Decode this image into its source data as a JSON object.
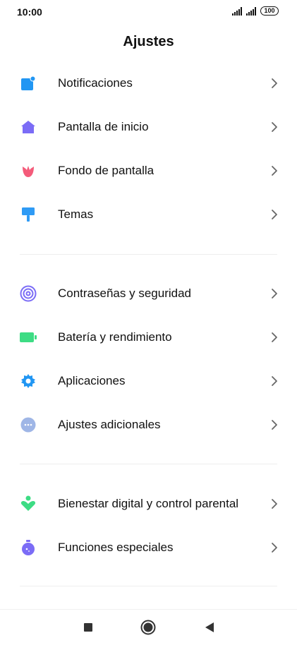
{
  "status_bar": {
    "time": "10:00",
    "battery": "100"
  },
  "header": {
    "title": "Ajustes"
  },
  "sections": [
    {
      "items": [
        {
          "label": "Notificaciones",
          "icon": "notifications-icon",
          "color": "#2196F3"
        },
        {
          "label": "Pantalla de inicio",
          "icon": "home-icon",
          "color": "#7B6CF6"
        },
        {
          "label": "Fondo de pantalla",
          "icon": "wallpaper-tulip-icon",
          "color": "#F45B7A"
        },
        {
          "label": "Temas",
          "icon": "themes-brush-icon",
          "color": "#2F9BF5"
        }
      ]
    },
    {
      "items": [
        {
          "label": "Contraseñas y seguridad",
          "icon": "fingerprint-icon",
          "color": "#7B6CF6"
        },
        {
          "label": "Batería y rendimiento",
          "icon": "battery-icon",
          "color": "#3DDC84"
        },
        {
          "label": "Aplicaciones",
          "icon": "gear-icon",
          "color": "#2196F3"
        },
        {
          "label": "Ajustes adicionales",
          "icon": "more-dots-icon",
          "color": "#9FB6E6"
        }
      ]
    },
    {
      "items": [
        {
          "label": "Bienestar digital y control parental",
          "icon": "digital-wellbeing-icon",
          "color": "#3DDC84"
        },
        {
          "label": "Funciones especiales",
          "icon": "special-features-flask-icon",
          "color": "#7B6CF6"
        }
      ]
    }
  ],
  "nav_bar": {
    "buttons": [
      "recents-square-icon",
      "home-circle-icon",
      "back-triangle-icon"
    ]
  }
}
